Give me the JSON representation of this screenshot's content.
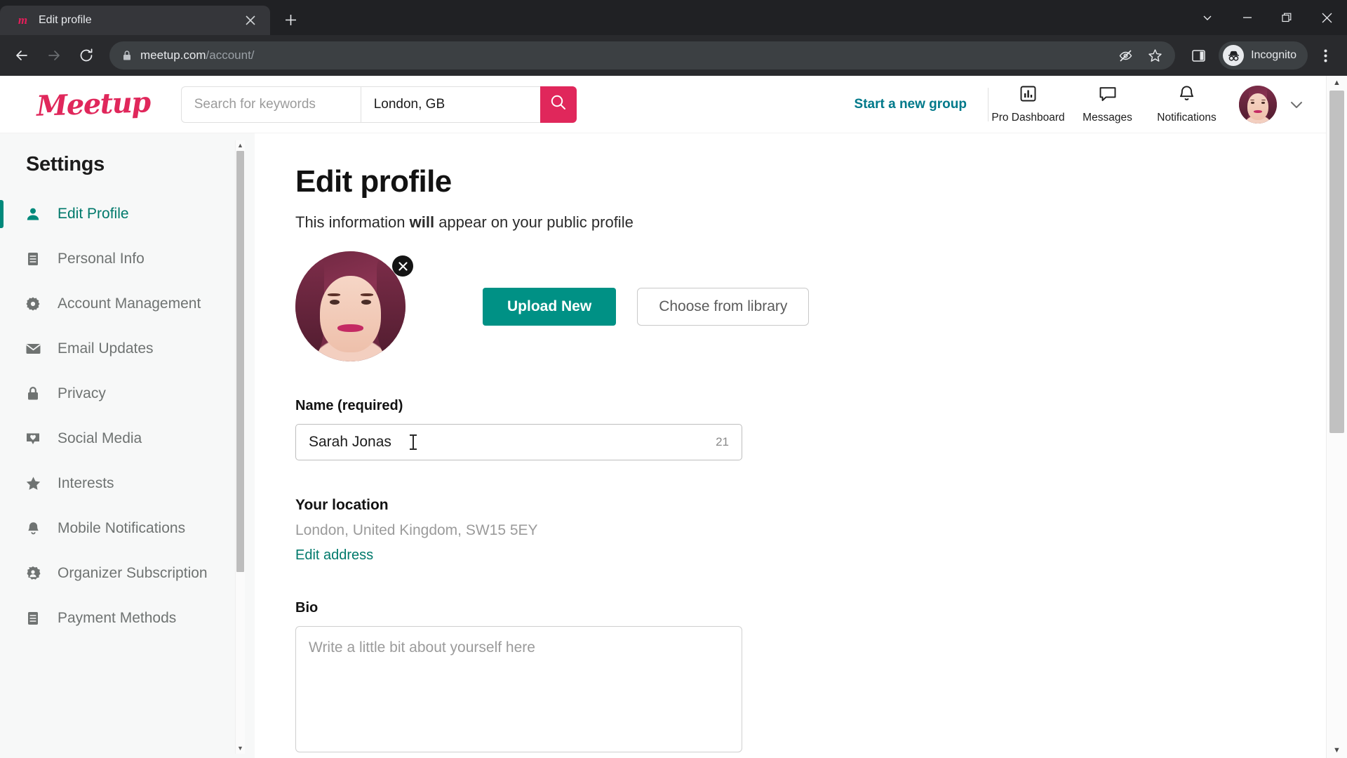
{
  "browser": {
    "tab": {
      "title": "Edit profile",
      "favicon": "meetup-favicon",
      "close": "×"
    },
    "new_tab": "+",
    "window_controls": {
      "minimize_chevron": "⌄",
      "minimize": "—",
      "maximize": "❐",
      "close": "✕"
    },
    "nav": {
      "back": "←",
      "forward": "→",
      "reload": "⟳"
    },
    "omnibox": {
      "lock_icon": "lock-icon",
      "url_host": "meetup.com",
      "url_path": "/account/",
      "tracking_protection_icon": "eye-slash-icon",
      "bookmark_icon": "star-icon"
    },
    "side_panel_icon": "side-panel-icon",
    "incognito_label": "Incognito",
    "menu_icon": "three-dot-menu-icon"
  },
  "site_header": {
    "logo": "Meetup",
    "search": {
      "keyword_placeholder": "Search for keywords",
      "location_value": "London, GB",
      "submit_icon": "search-icon"
    },
    "start_group_label": "Start a new group",
    "nav_items": [
      {
        "label": "Pro Dashboard",
        "icon": "bar-chart-icon"
      },
      {
        "label": "Messages",
        "icon": "chat-bubble-icon"
      },
      {
        "label": "Notifications",
        "icon": "bell-icon"
      }
    ],
    "account_chevron": "chevron-down-icon"
  },
  "sidebar": {
    "title": "Settings",
    "items": [
      {
        "label": "Edit Profile",
        "icon": "person-icon",
        "active": true
      },
      {
        "label": "Personal Info",
        "icon": "document-icon",
        "active": false
      },
      {
        "label": "Account Management",
        "icon": "gear-icon",
        "active": false
      },
      {
        "label": "Email Updates",
        "icon": "envelope-icon",
        "active": false
      },
      {
        "label": "Privacy",
        "icon": "lock-icon",
        "active": false
      },
      {
        "label": "Social Media",
        "icon": "heart-badge-icon",
        "active": false
      },
      {
        "label": "Interests",
        "icon": "star-icon",
        "active": false
      },
      {
        "label": "Mobile Notifications",
        "icon": "bell-icon",
        "active": false
      },
      {
        "label": "Organizer Subscription",
        "icon": "person-badge-icon",
        "active": false
      },
      {
        "label": "Payment Methods",
        "icon": "card-icon",
        "active": false
      }
    ],
    "scroll_up": "▲",
    "scroll_down": "▼"
  },
  "main": {
    "title": "Edit profile",
    "subtitle_pre": "This information ",
    "subtitle_bold": "will",
    "subtitle_post": " appear on your public profile",
    "photo": {
      "remove_icon": "close-icon",
      "upload_label": "Upload New",
      "library_label": "Choose from library"
    },
    "name_field": {
      "label": "Name (required)",
      "value": "Sarah Jonas",
      "char_count": "21"
    },
    "location": {
      "label": "Your location",
      "value": "London, United Kingdom, SW15 5EY",
      "edit_link": "Edit address"
    },
    "bio": {
      "label": "Bio",
      "placeholder": "Write a little bit about yourself here"
    },
    "scroll_up": "▲",
    "scroll_down": "▼"
  },
  "colors": {
    "brand_red": "#e0275b",
    "teal": "#00796b",
    "teal_button": "#009185",
    "chrome_dark": "#202124",
    "toolbar_dark": "#292a2d",
    "sidebar_bg": "#f7f8f8"
  }
}
